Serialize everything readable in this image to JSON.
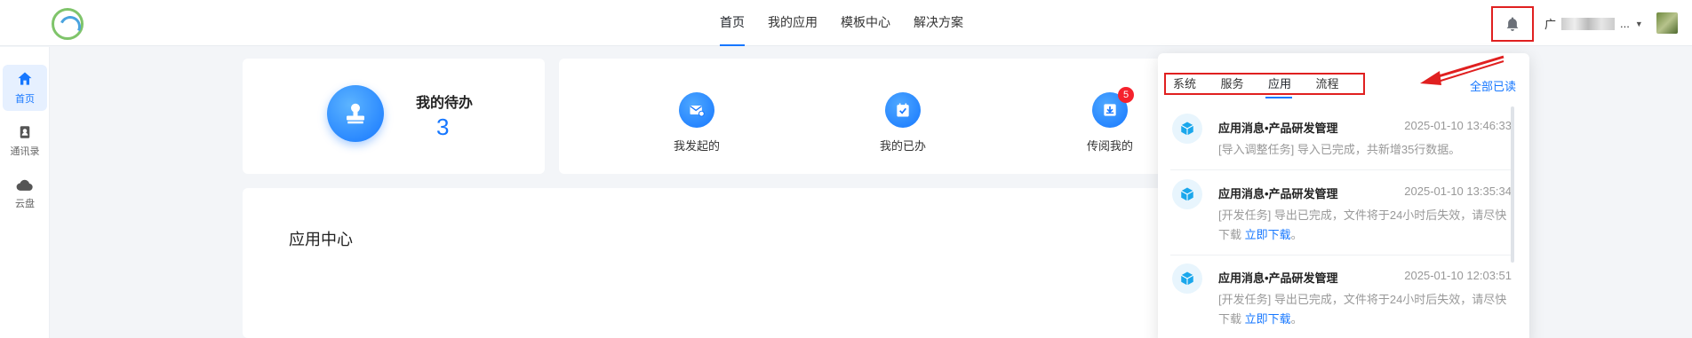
{
  "nav": {
    "items": [
      {
        "label": "首页",
        "active": true
      },
      {
        "label": "我的应用",
        "active": false
      },
      {
        "label": "模板中心",
        "active": false
      },
      {
        "label": "解决方案",
        "active": false
      }
    ]
  },
  "user": {
    "name_prefix": "广",
    "name_suffix": "...",
    "blurred": true
  },
  "sidebar": {
    "items": [
      {
        "label": "首页",
        "icon": "home-icon",
        "active": true
      },
      {
        "label": "通讯录",
        "icon": "contacts-icon",
        "active": false
      },
      {
        "label": "云盘",
        "icon": "cloud-icon",
        "active": false
      }
    ]
  },
  "todo": {
    "title": "我的待办",
    "count": "3"
  },
  "quick": {
    "items": [
      {
        "label": "我发起的",
        "icon": "mail-send-icon"
      },
      {
        "label": "我的已办",
        "icon": "calendar-check-icon"
      },
      {
        "label": "传阅我的",
        "icon": "inbox-download-icon",
        "badge": "5"
      }
    ]
  },
  "app_center": {
    "title": "应用中心"
  },
  "notifications": {
    "tabs": [
      {
        "label": "系统",
        "active": false
      },
      {
        "label": "服务",
        "active": false
      },
      {
        "label": "应用",
        "active": true
      },
      {
        "label": "流程",
        "active": false
      }
    ],
    "mark_all_read": "全部已读",
    "messages": [
      {
        "title": "应用消息•产品研发管理",
        "time": "2025-01-10 13:46:33",
        "body": "[导入调整任务] 导入已完成，共新增35行数据。",
        "link": ""
      },
      {
        "title": "应用消息•产品研发管理",
        "time": "2025-01-10 13:35:34",
        "body": "[开发任务] 导出已完成，文件将于24小时后失效，请尽快下载",
        "link": "立即下载",
        "suffix": "。"
      },
      {
        "title": "应用消息•产品研发管理",
        "time": "2025-01-10 12:03:51",
        "body": "[开发任务] 导出已完成，文件将于24小时后失效，请尽快下载",
        "link": "立即下载",
        "suffix": "。"
      }
    ]
  },
  "colors": {
    "accent": "#1677ff",
    "annotation": "#e02020",
    "badge": "#f5222d"
  }
}
